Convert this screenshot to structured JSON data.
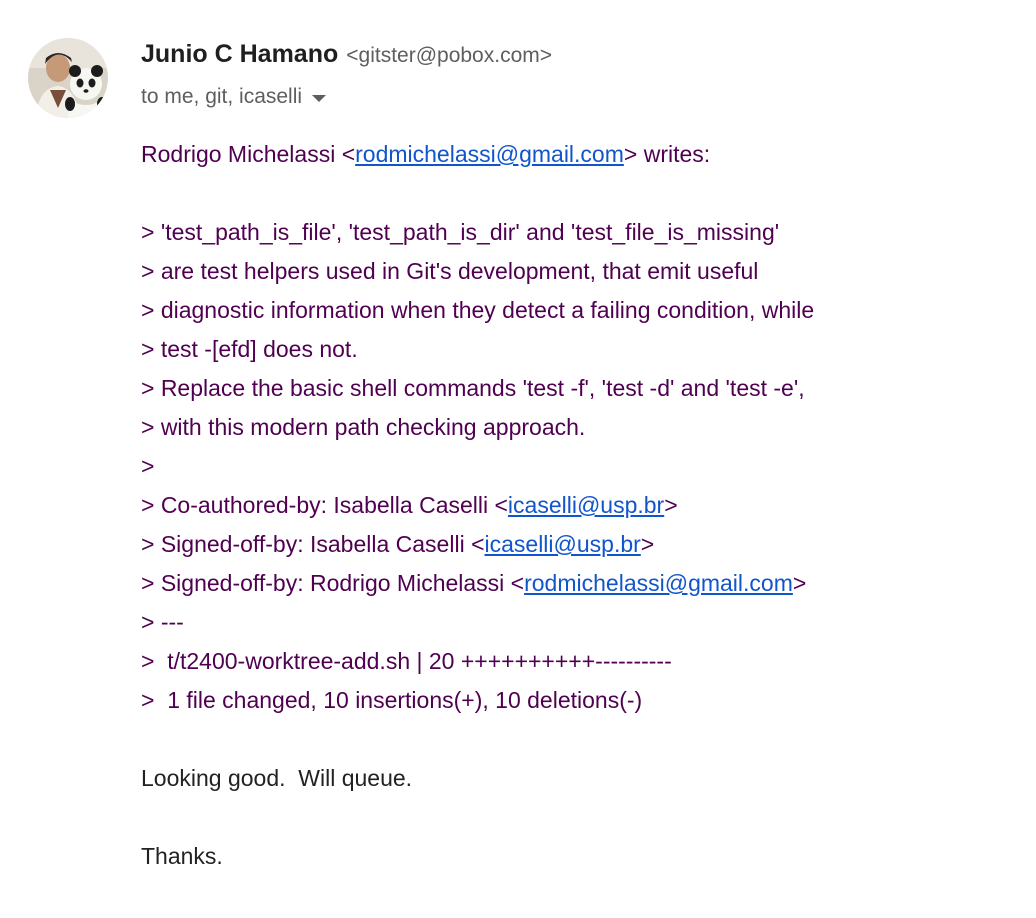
{
  "sender": {
    "name": "Junio C Hamano",
    "email": "<gitster@pobox.com>"
  },
  "recipients": "to me, git, icaselli",
  "body": {
    "attribution": {
      "before": "Rodrigo Michelassi <",
      "link": "rodmichelassi@gmail.com",
      "after": "> writes:"
    },
    "quote_lines": [
      "> 'test_path_is_file', 'test_path_is_dir' and 'test_file_is_missing'",
      "> are test helpers used in Git's development, that emit useful",
      "> diagnostic information when they detect a failing condition, while",
      "> test -[efd] does not.",
      "> Replace the basic shell commands 'test -f', 'test -d' and 'test -e',",
      "> with this modern path checking approach.",
      ">"
    ],
    "trailers": [
      {
        "before": "> Co-authored-by: Isabella Caselli <",
        "link": "icaselli@usp.br",
        "after": ">"
      },
      {
        "before": "> Signed-off-by: Isabella Caselli <",
        "link": "icaselli@usp.br",
        "after": ">"
      },
      {
        "before": "> Signed-off-by: Rodrigo Michelassi <",
        "link": "rodmichelassi@gmail.com",
        "after": ">"
      }
    ],
    "diffstat_lines": [
      "> ---",
      ">  t/t2400-worktree-add.sh | 20 ++++++++++----------",
      ">  1 file changed, 10 insertions(+), 10 deletions(-)"
    ],
    "reply_lines": [
      "Looking good.  Will queue.",
      "Thanks."
    ]
  },
  "colors": {
    "quoted_text": "#500050",
    "link": "#1155cc",
    "body_text": "#222222",
    "sender_name": "#1f1f1f",
    "secondary_text": "#5e5e5e"
  }
}
